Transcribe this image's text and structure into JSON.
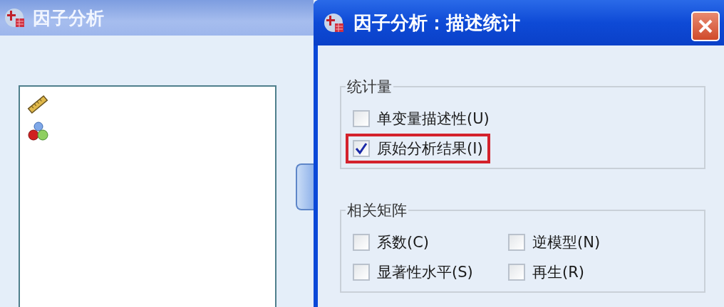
{
  "main_window": {
    "title": "因子分析"
  },
  "dialog": {
    "title": "因子分析：描述统计",
    "groups": [
      {
        "title": "统计量",
        "kind": "stacked",
        "items": [
          {
            "label": "单变量描述性(U)",
            "checked": false,
            "highlighted": false
          },
          {
            "label": "原始分析结果(I)",
            "checked": true,
            "highlighted": true
          }
        ]
      },
      {
        "title": "相关矩阵",
        "kind": "grid",
        "items": [
          {
            "label": "系数(C)",
            "checked": false,
            "highlighted": false
          },
          {
            "label": "逆模型(N)",
            "checked": false,
            "highlighted": false
          },
          {
            "label": "显著性水平(S)",
            "checked": false,
            "highlighted": false
          },
          {
            "label": "再生(R)",
            "checked": false,
            "highlighted": false
          }
        ]
      }
    ]
  }
}
